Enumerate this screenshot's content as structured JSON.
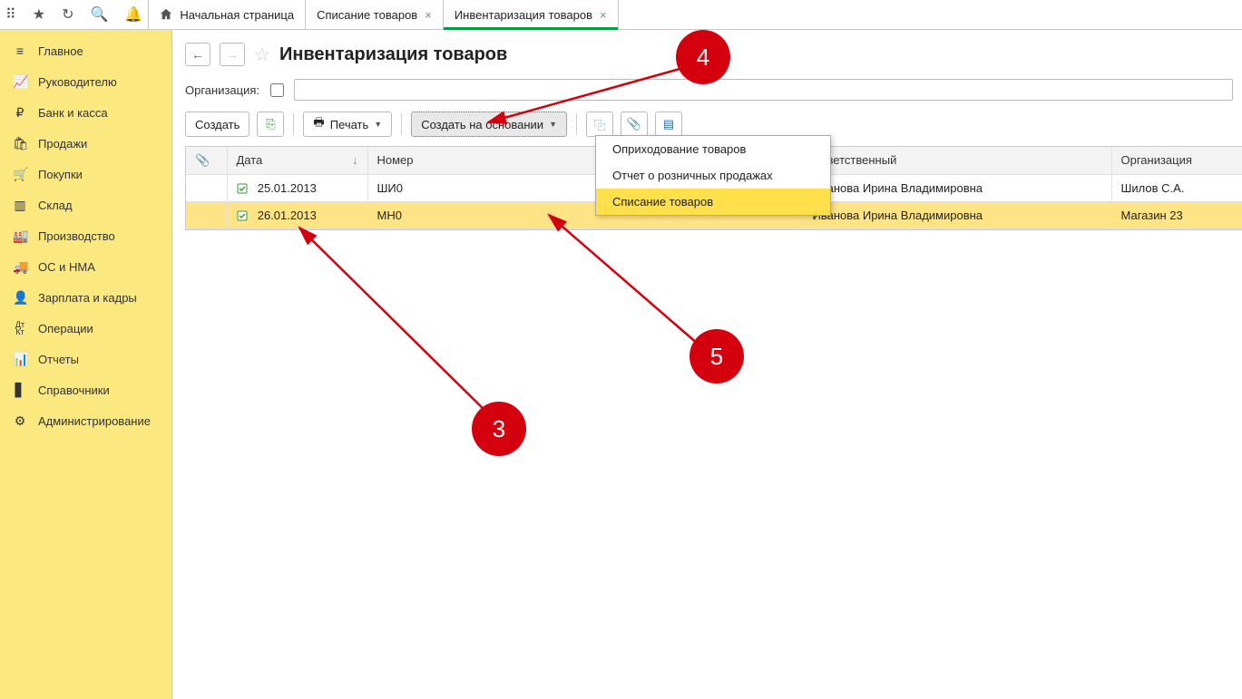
{
  "tabs": {
    "home": "Начальная страница",
    "t1": "Списание товаров",
    "t2": "Инвентаризация товаров"
  },
  "sidebar": [
    {
      "icon": "menu",
      "label": "Главное"
    },
    {
      "icon": "chart",
      "label": "Руководителю"
    },
    {
      "icon": "ruble",
      "label": "Банк и касса"
    },
    {
      "icon": "bag",
      "label": "Продажи"
    },
    {
      "icon": "cart",
      "label": "Покупки"
    },
    {
      "icon": "boxes",
      "label": "Склад"
    },
    {
      "icon": "factory",
      "label": "Производство"
    },
    {
      "icon": "truck",
      "label": "ОС и НМА"
    },
    {
      "icon": "person",
      "label": "Зарплата и кадры"
    },
    {
      "icon": "dkkt",
      "label": "Операции"
    },
    {
      "icon": "bars",
      "label": "Отчеты"
    },
    {
      "icon": "book",
      "label": "Справочники"
    },
    {
      "icon": "gear",
      "label": "Администрирование"
    }
  ],
  "page": {
    "title": "Инвентаризация товаров"
  },
  "filter": {
    "org_label": "Организация:"
  },
  "toolbar": {
    "create": "Создать",
    "print": "Печать",
    "create_based": "Создать на основании"
  },
  "menu": {
    "items": [
      "Оприходование товаров",
      "Отчет о розничных продажах",
      "Списание товаров"
    ]
  },
  "grid": {
    "headers": {
      "date": "Дата",
      "num": "Номер",
      "resp": "Ответственный",
      "org": "Организация"
    },
    "rows": [
      {
        "date": "25.01.2013",
        "num": "ШИ0",
        "resp": "Иванова Ирина Владимировна",
        "org": "Шилов С.А."
      },
      {
        "date": "26.01.2013",
        "num": "МН0",
        "resp": "Иванова Ирина Владимировна",
        "org": "Магазин 23"
      }
    ]
  },
  "annotations": {
    "b3": "3",
    "b4": "4",
    "b5": "5"
  }
}
